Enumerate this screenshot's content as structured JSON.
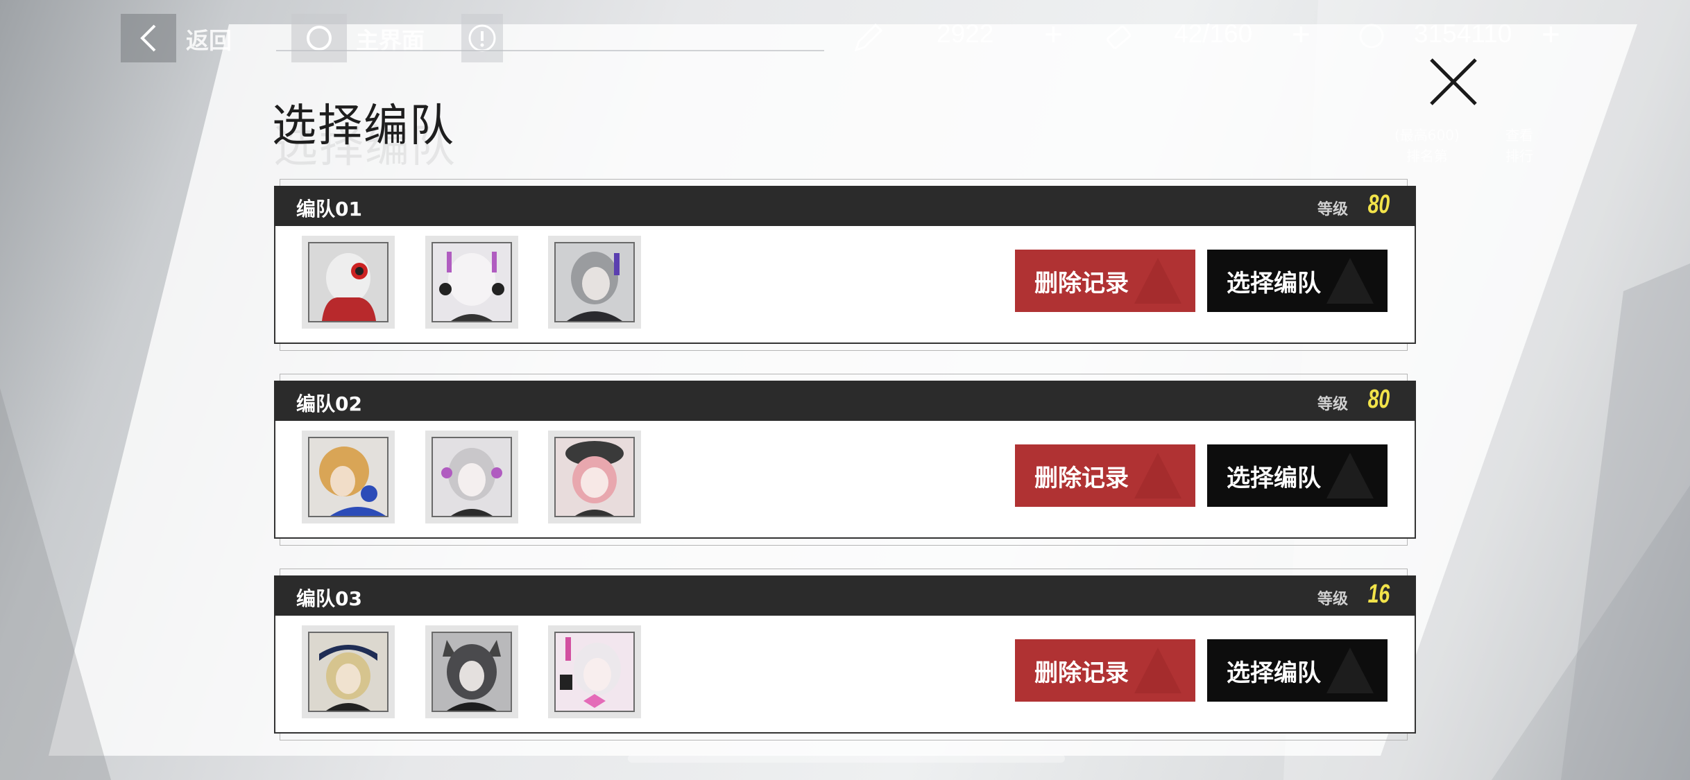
{
  "topbar": {
    "back_label": "返回",
    "home_label": "主界面",
    "resources": [
      {
        "icon": "pencil-icon",
        "value": "2922"
      },
      {
        "icon": "battery-icon",
        "value": "42/160"
      },
      {
        "icon": "coin-icon",
        "value": "3154110"
      }
    ],
    "plus_symbol": "+"
  },
  "ranking": {
    "info_line1": "(最高600)",
    "info_line2": "排名第",
    "view_line1": "查看",
    "view_line2": "排行"
  },
  "page": {
    "title": "选择编队"
  },
  "teams": [
    {
      "name": "编队01",
      "level_label": "等级",
      "level": "80",
      "avatars": [
        "avatar-white-hair-red-headphones",
        "avatar-white-hair-purple-ears",
        "avatar-grey-hair-dark"
      ],
      "delete_label": "删除记录",
      "select_label": "选择编队"
    },
    {
      "name": "编队02",
      "level_label": "等级",
      "level": "80",
      "avatars": [
        "avatar-blonde-blue-headphones",
        "avatar-white-hair-purple-ears",
        "avatar-pink-hair-beret"
      ],
      "delete_label": "删除记录",
      "select_label": "选择编队"
    },
    {
      "name": "编队03",
      "level_label": "等级",
      "level": "16",
      "avatars": [
        "avatar-blonde-cap",
        "avatar-dark-hair-cat-ears",
        "avatar-white-hair-pink-bow"
      ],
      "delete_label": "删除记录",
      "select_label": "选择编队"
    }
  ],
  "colors": {
    "delete_button": "#b03233",
    "select_button": "#0d0d0d",
    "header_bar": "#2b2b2b",
    "level_value": "#f2e34a"
  }
}
